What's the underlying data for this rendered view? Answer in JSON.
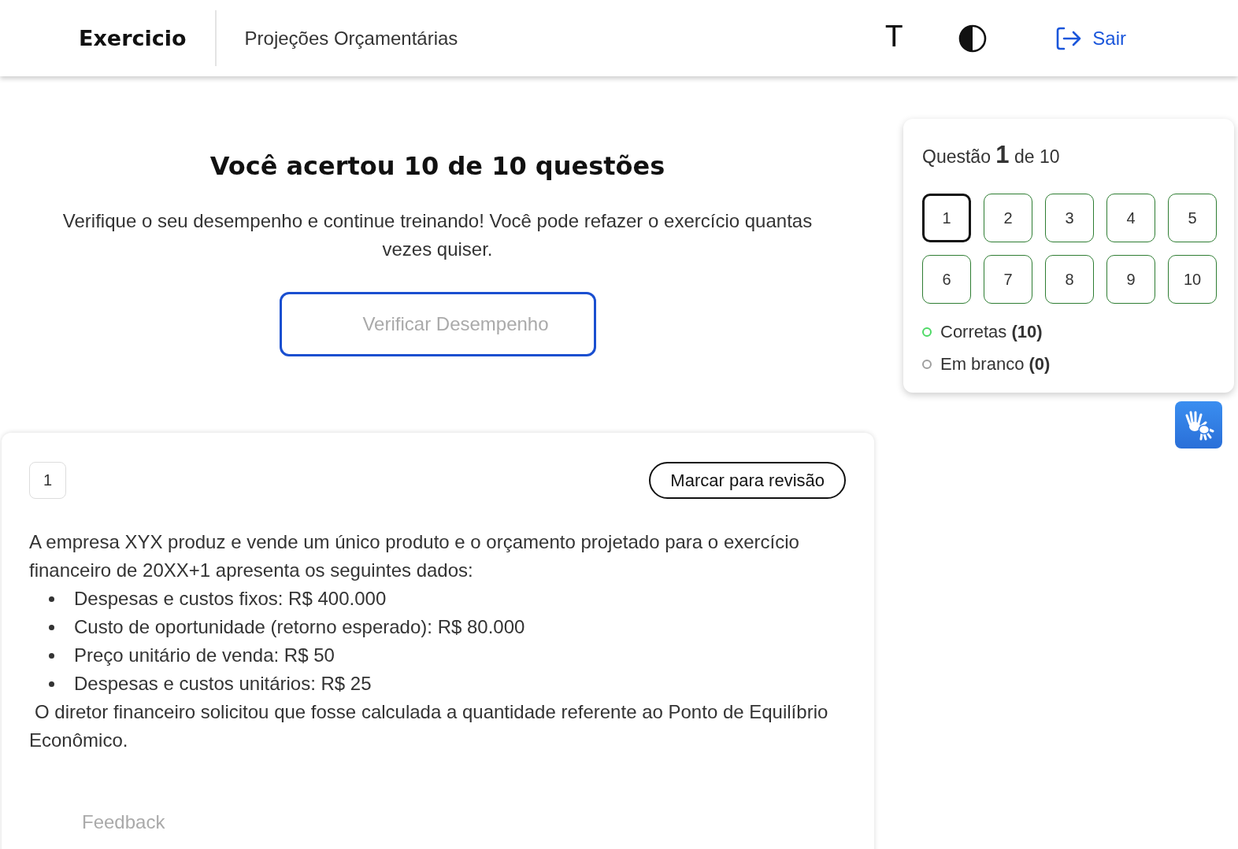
{
  "header": {
    "title": "Exercicio",
    "subtitle": "Projeções Orçamentárias",
    "font_button": "T",
    "logout": "Sair"
  },
  "result": {
    "heading": "Você acertou 10 de 10 questões",
    "message": "Verifique o seu desempenho e continue treinando! Você pode refazer o exercício quantas vezes quiser.",
    "button": "Verificar Desempenho"
  },
  "navigator": {
    "title": "Questão **1** de 10",
    "questions": [
      {
        "label": "1",
        "selected": true,
        "correct": true
      },
      {
        "label": "2",
        "selected": false,
        "correct": true
      },
      {
        "label": "3",
        "selected": false,
        "correct": true
      },
      {
        "label": "4",
        "selected": false,
        "correct": true
      },
      {
        "label": "5",
        "selected": false,
        "correct": true
      },
      {
        "label": "6",
        "selected": false,
        "correct": true
      },
      {
        "label": "7",
        "selected": false,
        "correct": true
      },
      {
        "label": "8",
        "selected": false,
        "correct": true
      },
      {
        "label": "9",
        "selected": false,
        "correct": true
      },
      {
        "label": "10",
        "selected": false,
        "correct": true
      }
    ],
    "legend": [
      {
        "label": "Corretas **(10)**",
        "color": "#4cd964"
      },
      {
        "label": "Em branco **(0)**",
        "color": "#9e9e9e"
      }
    ]
  },
  "question": {
    "number": "1",
    "review_button": "Marcar para revisão",
    "intro": "A empresa XYX produz e vende um único produto e o orçamento projetado para o exercício financeiro de 20XX+1 apresenta os seguintes dados:",
    "items": [
      "Despesas e custos fixos: R$ 400.000",
      "Custo de oportunidade (retorno esperado): R$ 80.000",
      "Preço unitário de venda: R$ 50",
      "Despesas e custos unitários: R$ 25"
    ],
    "closing": "O diretor financeiro solicitou que fosse calculada a quantidade referente ao Ponto de Equilíbrio Econômico.",
    "feedback": "Feedback"
  }
}
